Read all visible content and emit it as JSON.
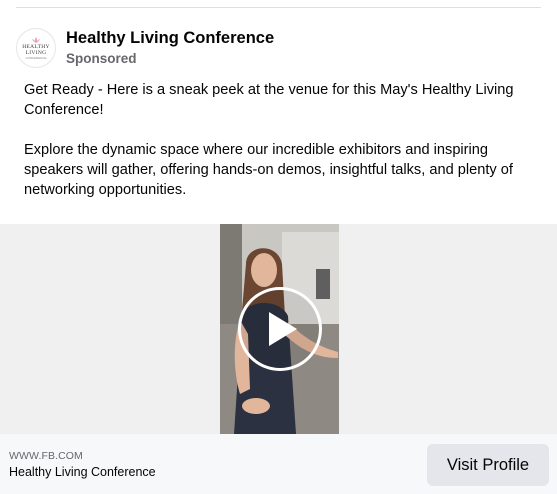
{
  "post": {
    "page_name": "Healthy Living Conference",
    "sponsored_label": "Sponsored",
    "avatar": {
      "logo_line_1": "HEALTHY",
      "logo_line_2": "LIVING",
      "logo_subtext": "CONFERENCE"
    },
    "paragraphs": [
      "Get Ready - Here is a sneak peek at the venue for this May's Healthy Living Conference!",
      "Explore the dynamic space where our incredible exhibitors and inspiring speakers will gather, offering hands-on demos, insightful talks, and plenty of networking opportunities."
    ],
    "truncation": "…"
  },
  "media": {
    "type": "video",
    "play_icon": "play-icon"
  },
  "footer": {
    "domain": "WWW.FB.COM",
    "title": "Healthy Living Conference",
    "cta_label": "Visit Profile"
  },
  "colors": {
    "text_primary": "#050505",
    "text_secondary": "#65676b",
    "button_bg": "#e4e6eb",
    "footer_bg": "#f7f8fa",
    "media_bg": "#f0f0f0"
  }
}
